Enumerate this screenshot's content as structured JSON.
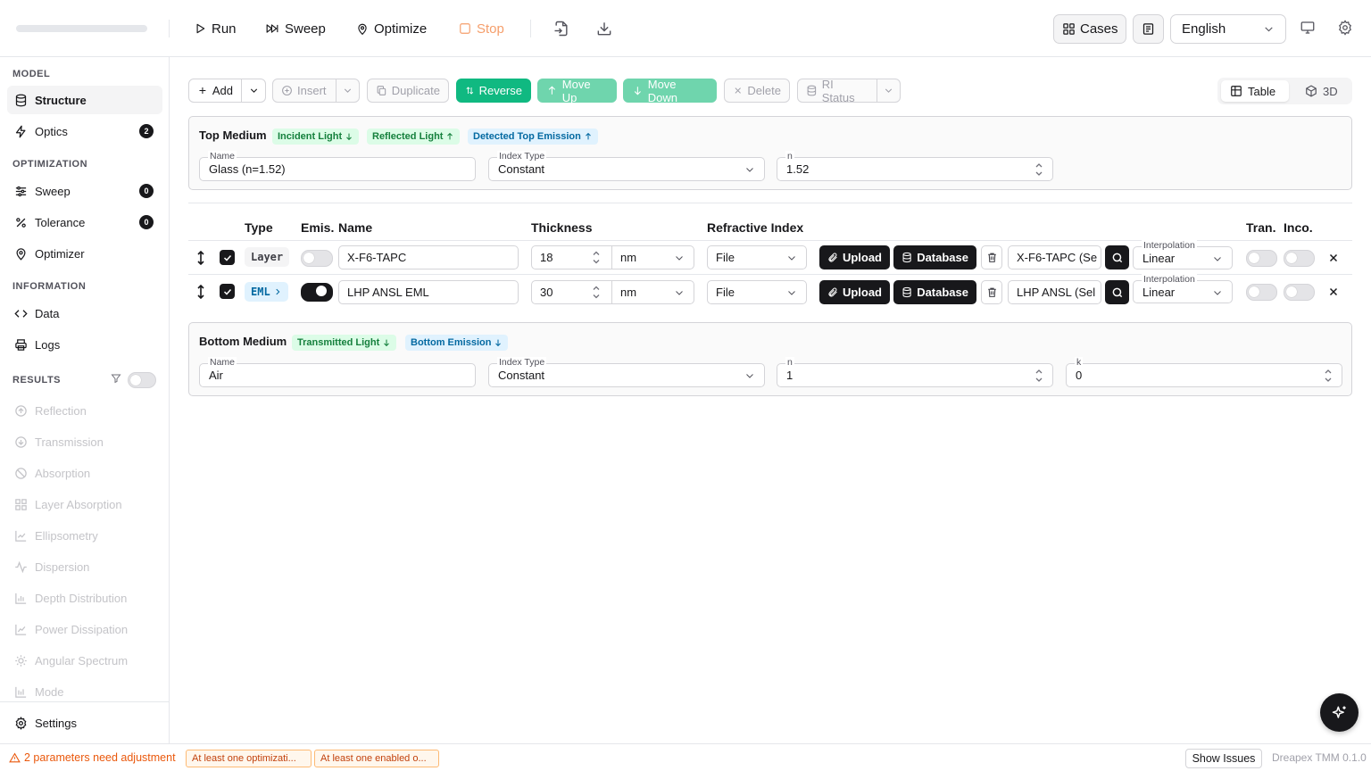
{
  "topbar": {
    "run": "Run",
    "sweep": "Sweep",
    "optimize": "Optimize",
    "stop": "Stop",
    "cases": "Cases",
    "language": "English"
  },
  "sidebar": {
    "model_title": "MODEL",
    "structure": "Structure",
    "optics": "Optics",
    "optics_count": "2",
    "optimization_title": "OPTIMIZATION",
    "sweep": "Sweep",
    "sweep_count": "0",
    "tolerance": "Tolerance",
    "tolerance_count": "0",
    "optimizer": "Optimizer",
    "information_title": "INFORMATION",
    "data": "Data",
    "logs": "Logs",
    "results_title": "RESULTS",
    "results": [
      "Reflection",
      "Transmission",
      "Absorption",
      "Layer Absorption",
      "Ellipsometry",
      "Dispersion",
      "Depth Distribution",
      "Power Dissipation",
      "Angular Spectrum",
      "Mode"
    ],
    "settings": "Settings"
  },
  "toolbar": {
    "add": "Add",
    "insert": "Insert",
    "duplicate": "Duplicate",
    "reverse": "Reverse",
    "move_up": "Move Up",
    "move_down": "Move Down",
    "delete": "Delete",
    "ri_status": "RI Status",
    "view_table": "Table",
    "view_3d": "3D"
  },
  "top_medium": {
    "title": "Top Medium",
    "tags": [
      "Incident Light",
      "Reflected Light",
      "Detected Top Emission"
    ],
    "name_label": "Name",
    "name": "Glass (n=1.52)",
    "index_type_label": "Index Type",
    "index_type": "Constant",
    "n_label": "n",
    "n": "1.52"
  },
  "table": {
    "headers": {
      "type": "Type",
      "emis": "Emis.",
      "name": "Name",
      "thickness": "Thickness",
      "refractive_index": "Refractive Index",
      "tran": "Tran.",
      "inco": "Inco."
    },
    "upload": "Upload",
    "database": "Database",
    "interpolation_label": "Interpolation",
    "rows": [
      {
        "type": "Layer",
        "name": "X-F6-TAPC",
        "thickness": "18",
        "unit": "nm",
        "ri_source": "File",
        "material": "X-F6-TAPC (Se",
        "interpolation": "Linear"
      },
      {
        "type": "EML",
        "name": "LHP ANSL EML",
        "thickness": "30",
        "unit": "nm",
        "ri_source": "File",
        "material": "LHP ANSL (Sel",
        "interpolation": "Linear"
      }
    ]
  },
  "bottom_medium": {
    "title": "Bottom Medium",
    "tags": [
      "Transmitted Light",
      "Bottom Emission"
    ],
    "name_label": "Name",
    "name": "Air",
    "index_type_label": "Index Type",
    "index_type": "Constant",
    "n_label": "n",
    "n": "1",
    "k_label": "k",
    "k": "0"
  },
  "status": {
    "warning": "2 parameters need adjustment",
    "chips": [
      "At least one optimizati...",
      "At least one enabled o..."
    ],
    "show_issues": "Show Issues",
    "version": "Dreapex TMM 0.1.0"
  },
  "colors": {
    "accent_green": "#10b981",
    "warning_orange": "#ea580c",
    "dark": "#18181b"
  }
}
